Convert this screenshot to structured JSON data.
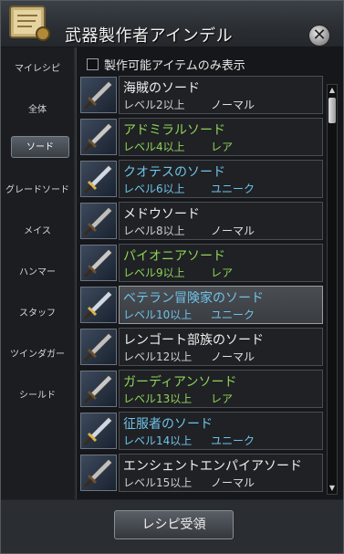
{
  "window": {
    "title": "武器製作者アインデル",
    "close_label": "✕"
  },
  "sidebar": {
    "items": [
      {
        "label": "マイレシピ",
        "selected": false
      },
      {
        "label": "全体",
        "selected": false
      },
      {
        "label": "ソード",
        "selected": true
      },
      {
        "label": "グレードソード",
        "selected": false
      },
      {
        "label": "メイス",
        "selected": false
      },
      {
        "label": "ハンマー",
        "selected": false
      },
      {
        "label": "スタッフ",
        "selected": false
      },
      {
        "label": "ツインダガー",
        "selected": false
      },
      {
        "label": "シールド",
        "selected": false
      }
    ]
  },
  "filter": {
    "label": "製作可能アイテムのみ表示",
    "checked": false
  },
  "colors": {
    "level_normal": "#d0d0d0",
    "level_rare": "#8fd35a",
    "level_unique": "#6fc3ea",
    "rarity_normal": "#e0e0e0",
    "rarity_rare": "#8fd35a",
    "rarity_unique": "#6fc3ea",
    "name_rare": "#8fd35a",
    "name_unique": "#6fc3ea"
  },
  "recipes": [
    {
      "name": "海賊のソード",
      "level": "レベル2以上",
      "rarity": "ノーマル",
      "tier": "normal",
      "icon": "sword-icon",
      "selected": false
    },
    {
      "name": "アドミラルソード",
      "level": "レベル4以上",
      "rarity": "レア",
      "tier": "rare",
      "icon": "sword-icon",
      "selected": false
    },
    {
      "name": "クオテスのソード",
      "level": "レベル6以上",
      "rarity": "ユニーク",
      "tier": "unique",
      "icon": "sword-icon",
      "selected": false
    },
    {
      "name": "メドウソード",
      "level": "レベル8以上",
      "rarity": "ノーマル",
      "tier": "normal",
      "icon": "sword-icon",
      "selected": false
    },
    {
      "name": "パイオニアソード",
      "level": "レベル9以上",
      "rarity": "レア",
      "tier": "rare",
      "icon": "sword-icon",
      "selected": false
    },
    {
      "name": "ベテラン冒険家のソード",
      "level": "レベル10以上",
      "rarity": "ユニーク",
      "tier": "unique",
      "icon": "sword-icon",
      "selected": true
    },
    {
      "name": "レンゴート部族のソード",
      "level": "レベル12以上",
      "rarity": "ノーマル",
      "tier": "normal",
      "icon": "sword-icon",
      "selected": false
    },
    {
      "name": "ガーディアンソード",
      "level": "レベル13以上",
      "rarity": "レア",
      "tier": "rare",
      "icon": "sword-icon",
      "selected": false
    },
    {
      "name": "征服者のソード",
      "level": "レベル14以上",
      "rarity": "ユニーク",
      "tier": "unique",
      "icon": "sword-icon",
      "selected": false
    },
    {
      "name": "エンシェントエンパイアソード",
      "level": "レベル15以上",
      "rarity": "ノーマル",
      "tier": "normal",
      "icon": "sword-icon",
      "selected": false
    }
  ],
  "scroll": {
    "up_icon": "scroll-up-icon",
    "down_icon": "scroll-down-icon",
    "position": 0.0
  },
  "footer": {
    "receive_label": "レシピ受領"
  }
}
